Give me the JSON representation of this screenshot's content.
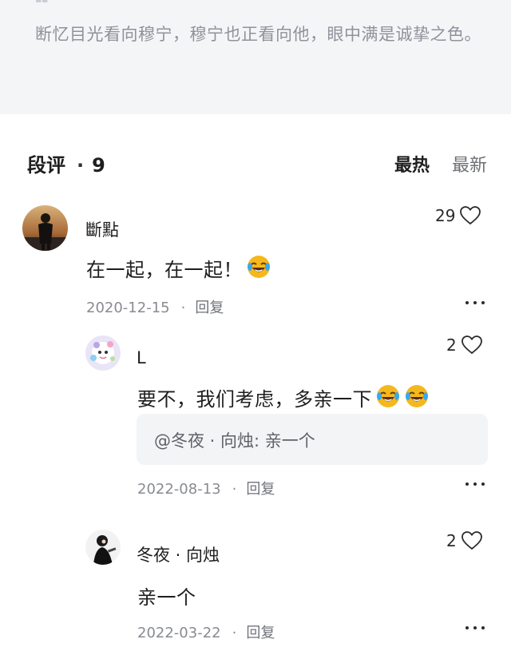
{
  "chapter_quote": {
    "text": "断忆目光看向穆宁，穆宁也正看向他，眼中满是诚挚之色。"
  },
  "comments_header": {
    "title": "段评",
    "separator": "·",
    "count": "9",
    "tab_hot": "最热",
    "tab_new": "最新"
  },
  "comments": [
    {
      "username": "斷點",
      "content": "在一起，在一起！",
      "emoji": "laughing-tears-emoji",
      "date": "2020-12-15",
      "reply_label": "回复",
      "likes": "29"
    },
    {
      "username": "L",
      "content": "要不，我们考虑，多亲一下",
      "emoji": "laughing-tears-emoji",
      "quoted": "@冬夜 · 向烛: 亲一个",
      "date": "2022-08-13",
      "reply_label": "回复",
      "likes": "2"
    },
    {
      "username": "冬夜 · 向烛",
      "content": "亲一个",
      "date": "2022-03-22",
      "reply_label": "回复",
      "likes": "2"
    }
  ],
  "meta_separator": "·",
  "colors": {
    "quote_bg": "#f4f5f7",
    "quote_text": "#8e929a",
    "meta_text": "#888b92",
    "emoji_face": "#f5b81c"
  }
}
